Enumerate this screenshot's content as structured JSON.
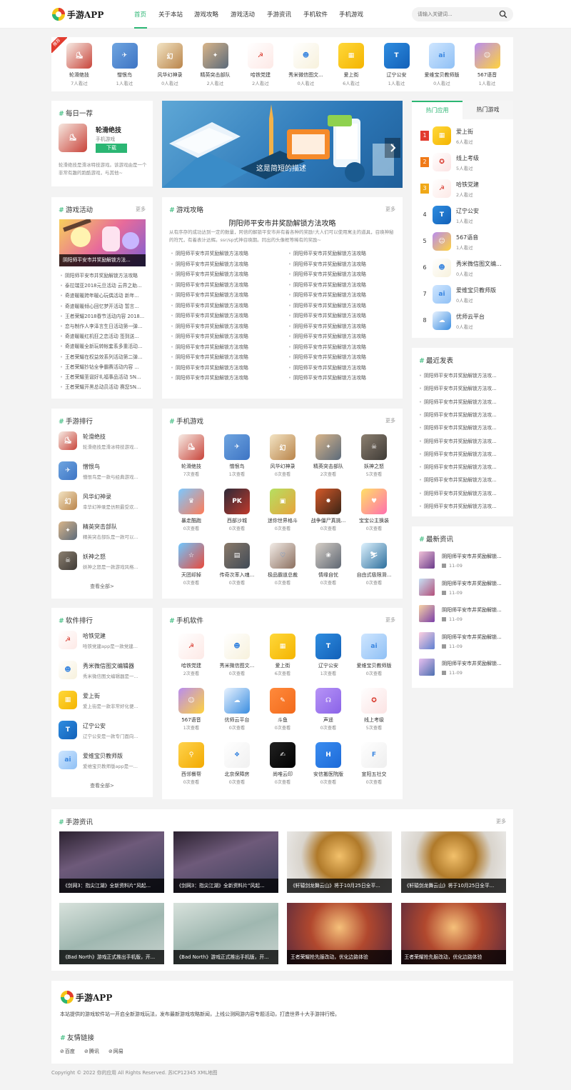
{
  "header": {
    "logo_text": "手游APP",
    "nav": [
      "首页",
      "关于本站",
      "游戏攻略",
      "游戏活动",
      "手游资讯",
      "手机软件",
      "手机游戏"
    ],
    "search_placeholder": "请输入关键词..."
  },
  "colors": {
    "accent": "#2bb673",
    "rank1": "#e23b2e",
    "rank2": "#f07a18",
    "rank3": "#f0a818"
  },
  "top_apps": [
    {
      "name": "轮滑绝技",
      "views": "7人看过",
      "badge": "推荐",
      "icon": "game-skater-icon"
    },
    {
      "name": "憎恨鸟",
      "views": "1人看过",
      "icon": "bird-icon"
    },
    {
      "name": "风华幻神录",
      "views": "0人看过",
      "icon": "calligraphy-icon"
    },
    {
      "name": "精英突击部队",
      "views": "2人看过",
      "icon": "soldier-icon"
    },
    {
      "name": "哈铁党建",
      "views": "2人看过",
      "icon": "party-logo-icon"
    },
    {
      "name": "秀米微信图文...",
      "views": "0人看过",
      "icon": "xiumi-icon"
    },
    {
      "name": "爱上街",
      "views": "6人看过",
      "icon": "shopping-bag-icon"
    },
    {
      "name": "辽宁公安",
      "views": "1人看过",
      "icon": "police-icon"
    },
    {
      "name": "爱维宝贝教师版",
      "views": "0人看过",
      "icon": "ai-icon"
    },
    {
      "name": "567语音",
      "views": "1人看过",
      "icon": "emoji-icon"
    }
  ],
  "daily": {
    "title": "每日一荐",
    "app_name": "轮滑绝技",
    "category": "手机游戏",
    "download": "下载",
    "desc": "轮滑绝技是滑冰特技游戏。该游戏由是一个非常有趣的跑酷游戏，与其他~"
  },
  "banner": {
    "caption": "这是简短的描述"
  },
  "tabs": [
    "热门应用",
    "热门游戏"
  ],
  "hot_apps": [
    {
      "rank": "1",
      "name": "爱上街",
      "views": "6人看过",
      "icon": "shopping-bag-icon"
    },
    {
      "rank": "2",
      "name": "线上考级",
      "views": "5人看过",
      "icon": "exam-icon"
    },
    {
      "rank": "3",
      "name": "哈铁党建",
      "views": "2人看过",
      "icon": "party-logo-icon"
    },
    {
      "rank": "4",
      "name": "辽宁公安",
      "views": "1人看过",
      "icon": "police-icon"
    },
    {
      "rank": "5",
      "name": "567语音",
      "views": "1人看过",
      "icon": "emoji-icon"
    },
    {
      "rank": "6",
      "name": "秀米微信图文编...",
      "views": "0人看过",
      "icon": "xiumi-icon"
    },
    {
      "rank": "7",
      "name": "爱维宝贝教师版",
      "views": "0人看过",
      "icon": "ai-icon"
    },
    {
      "rank": "8",
      "name": "优师云平台",
      "views": "0人看过",
      "icon": "cloud-icon"
    }
  ],
  "activities": {
    "title": "游戏活动",
    "more": "更多",
    "cover_caption": "阴阳师平安市井奖励解锁方法...",
    "items": [
      "阴阳师平安市井奖励解锁方法攻略",
      "泰拉瑞亚2018元旦活动 云界之助...",
      "奇迹暖暖跨年暖心玩偶活动 新年...",
      "奇迹暖暖倾心回忆梦开活动 暂言...",
      "王者荣耀2018春节活动内容 2018...",
      "恋与制作人李泽言生日活动第一弹...",
      "奇迹暖暖红机狂之恋活动 签到送...",
      "奇迹暖暖全新玩转帐套系多重活动...",
      "王者荣耀在权益效系列活动第二弹...",
      "王者荣耀抄钻全争霸赛活动内容 ...",
      "王者荣耀圣诞好礼福事品活动 SN...",
      "王者荣耀开黑总动员活动 赛您SN..."
    ]
  },
  "strategy": {
    "title": "游戏攻略",
    "more": "更多",
    "headline": "阴阳师平安市井奖励解锁方法攻略",
    "summary": "从有序存的成功达到一定的数量，阿倍的解锁平安市井有着各种的奖励!大人们可以使用寓主的道具，召唤神秘的符咒，有着表计达辉。ssr/sp式神召唤期。同出的头像框等稀有的奖励~",
    "left_items": [
      "阴阳师平安市井奖励解锁方法攻略",
      "阴阳师平安市井奖励解锁方法攻略",
      "阴阳师平安市井奖励解锁方法攻略",
      "阴阳师平安市井奖励解锁方法攻略",
      "阴阳师平安市井奖励解锁方法攻略",
      "阴阳师平安市井奖励解锁方法攻略",
      "阴阳师平安市井奖励解锁方法攻略",
      "阴阳师平安市井奖励解锁方法攻略",
      "阴阳师平安市井奖励解锁方法攻略",
      "阴阳师平安市井奖励解锁方法攻略",
      "阴阳师平安市井奖励解锁方法攻略",
      "阴阳师平安市井奖励解锁方法攻略",
      "阴阳师平安市井奖励解锁方法攻略"
    ],
    "right_items": [
      "阴阳师平安市井奖励解锁方法攻略",
      "阴阳师平安市井奖励解锁方法攻略",
      "阴阳师平安市井奖励解锁方法攻略",
      "阴阳师平安市井奖励解锁方法攻略",
      "阴阳师平安市井奖励解锁方法攻略",
      "阴阳师平安市井奖励解锁方法攻略",
      "阴阳师平安市井奖励解锁方法攻略",
      "阴阳师平安市井奖励解锁方法攻略",
      "阴阳师平安市井奖励解锁方法攻略",
      "阴阳师平安市井奖励解锁方法攻略",
      "阴阳师平安市井奖励解锁方法攻略",
      "阴阳师平安市井奖励解锁方法攻略",
      "阴阳师平安市井奖励解锁方法攻略"
    ]
  },
  "recent_posts": {
    "title": "最近发表",
    "items": [
      "阴阳师平安市井奖励解锁方法攻...",
      "阴阳师平安市井奖励解锁方法攻...",
      "阴阳师平安市井奖励解锁方法攻...",
      "阴阳师平安市井奖励解锁方法攻...",
      "阴阳师平安市井奖励解锁方法攻...",
      "阴阳师平安市井奖励解锁方法攻...",
      "阴阳师平安市井奖励解锁方法攻...",
      "阴阳师平安市井奖励解锁方法攻...",
      "阴阳师平安市井奖励解锁方法攻...",
      "阴阳师平安市井奖励解锁方法攻...",
      "阴阳师平安市井奖励解锁方法攻..."
    ]
  },
  "game_rank": {
    "title": "手游排行",
    "see_all": "查看全部>",
    "items": [
      {
        "name": "轮滑绝技",
        "desc": "轮滑绝技是滑冰特技游戏...",
        "icon": "game-skater-icon"
      },
      {
        "name": "憎恨鸟",
        "desc": "憎恨鸟是一款与经典游戏...",
        "icon": "bird-icon"
      },
      {
        "name": "风华幻神录",
        "desc": "幸华幻神录是仿照最受欢...",
        "icon": "calligraphy-icon"
      },
      {
        "name": "精英突击部队",
        "desc": "精英突击部队是一款可以...",
        "icon": "soldier-icon"
      },
      {
        "name": "妖神之怒",
        "desc": "妖神之怒是一款游戏风格...",
        "icon": "monster-icon"
      }
    ]
  },
  "mobile_games": {
    "title": "手机游戏",
    "more": "更多",
    "items": [
      {
        "name": "轮滑绝技",
        "views": "7次查看",
        "icon": "game-skater-icon"
      },
      {
        "name": "憎恨鸟",
        "views": "1次查看",
        "icon": "bird-icon"
      },
      {
        "name": "风华幻神录",
        "views": "0次查看",
        "icon": "calligraphy-icon"
      },
      {
        "name": "精英突击部队",
        "views": "2次查看",
        "icon": "soldier-icon"
      },
      {
        "name": "妖神之怒",
        "views": "5次查看",
        "icon": "monster-icon"
      },
      {
        "name": "暴走酷跑",
        "views": "0次查看",
        "icon": "runner-icon"
      },
      {
        "name": "西部沙城",
        "views": "0次查看",
        "icon": "pk-icon"
      },
      {
        "name": "迷你世界格斗",
        "views": "0次查看",
        "icon": "block-icon"
      },
      {
        "name": "战争僵尸真挑...",
        "views": "0次查看",
        "icon": "zombie-icon"
      },
      {
        "name": "宝宝公主换装",
        "views": "0次查看",
        "icon": "princess-icon"
      },
      {
        "name": "天团却掉",
        "views": "0次查看",
        "icon": "race-icon"
      },
      {
        "name": "传奇次率入魂...",
        "views": "0次查看",
        "icon": "city-icon"
      },
      {
        "name": "极品霸道总裁",
        "views": "0次查看",
        "icon": "romance-icon"
      },
      {
        "name": "情缘自忧",
        "views": "0次查看",
        "icon": "girl-icon"
      },
      {
        "name": "自由式极限滑...",
        "views": "0次查看",
        "icon": "ski-icon"
      }
    ]
  },
  "latest_news": {
    "title": "最新资讯",
    "items": [
      {
        "title": "阴阳师平安市井奖励解锁...",
        "date": "11-09"
      },
      {
        "title": "阴阳师平安市井奖励解锁...",
        "date": "11-09"
      },
      {
        "title": "阴阳师平安市井奖励解锁...",
        "date": "11-09"
      },
      {
        "title": "阴阳师平安市井奖励解锁...",
        "date": "11-09"
      },
      {
        "title": "阴阳师平安市井奖励解锁...",
        "date": "11-09"
      }
    ]
  },
  "soft_rank": {
    "title": "软件排行",
    "see_all": "查看全部>",
    "items": [
      {
        "name": "哈铁党建",
        "desc": "哈铁党建app是一款党建...",
        "icon": "party-logo-icon"
      },
      {
        "name": "秀米微信图文编辑器",
        "desc": "秀米微信图文编辑器是一...",
        "icon": "xiumi-icon"
      },
      {
        "name": "爱上街",
        "desc": "爱上街是一款非常好化便...",
        "icon": "shopping-bag-icon"
      },
      {
        "name": "辽宁公安",
        "desc": "辽宁公安是一款专门面向...",
        "icon": "police-icon"
      },
      {
        "name": "爱维宝贝教师版",
        "desc": "爱维宝贝教师版app是一...",
        "icon": "ai-icon"
      }
    ]
  },
  "mobile_software": {
    "title": "手机软件",
    "more": "更多",
    "items": [
      {
        "name": "哈铁党建",
        "views": "2次查看",
        "icon": "party-logo-icon"
      },
      {
        "name": "秀米微信图文...",
        "views": "0次查看",
        "icon": "xiumi-icon"
      },
      {
        "name": "爱上街",
        "views": "6次查看",
        "icon": "shopping-bag-icon"
      },
      {
        "name": "辽宁公安",
        "views": "1次查看",
        "icon": "police-icon"
      },
      {
        "name": "爱维宝贝教师版",
        "views": "0次查看",
        "icon": "ai-icon"
      },
      {
        "name": "567语音",
        "views": "1次查看",
        "icon": "emoji-icon"
      },
      {
        "name": "优师云平台",
        "views": "0次查看",
        "icon": "cloud-icon"
      },
      {
        "name": "斗鱼",
        "views": "0次查看",
        "icon": "fish-icon"
      },
      {
        "name": "声遥",
        "views": "0次查看",
        "icon": "voice-icon"
      },
      {
        "name": "线上考级",
        "views": "5次查看",
        "icon": "exam-icon"
      },
      {
        "name": "西邻餐帮",
        "views": "0次查看",
        "icon": "food-icon"
      },
      {
        "name": "北京保障房",
        "views": "0次查看",
        "icon": "house-icon"
      },
      {
        "name": "尚唯云印",
        "views": "0次查看",
        "icon": "print-icon"
      },
      {
        "name": "安信搬医院版",
        "views": "0次查看",
        "icon": "hospital-icon"
      },
      {
        "name": "宣阳五社交",
        "views": "0次查看",
        "icon": "social-icon"
      }
    ]
  },
  "news_section": {
    "title": "手游资讯",
    "more": "更多",
    "items": [
      "《剑网3：指尖江湖》全新资料片“风起...",
      "《剑网3：指尖江湖》全新资料片“风起...",
      "《轩辕剑龙舞云山》将于10月25日全平...",
      "《轩辕剑龙舞云山》将于10月25日全平...",
      "《Bad North》游戏正式推出手机版，开...",
      "《Bad North》游戏正式推出手机版，开...",
      "王者荣耀抢先服改动，优化边路体验",
      "王者荣耀抢先服改动，优化边路体验"
    ]
  },
  "footer": {
    "logo_text": "手游APP",
    "about": "本站提供的游戏软件站一开启全新游戏玩法，发布最新游戏攻略新闻，上线公测网游内容专题活动，打造世界十大手游排行榜。",
    "links_title": "友情链接",
    "links": [
      "百度",
      "腾讯",
      "网易"
    ],
    "copyright": "Copyright © 2022 你的应用 All Rights Reserved. 苏ICP12345 XML地图"
  }
}
